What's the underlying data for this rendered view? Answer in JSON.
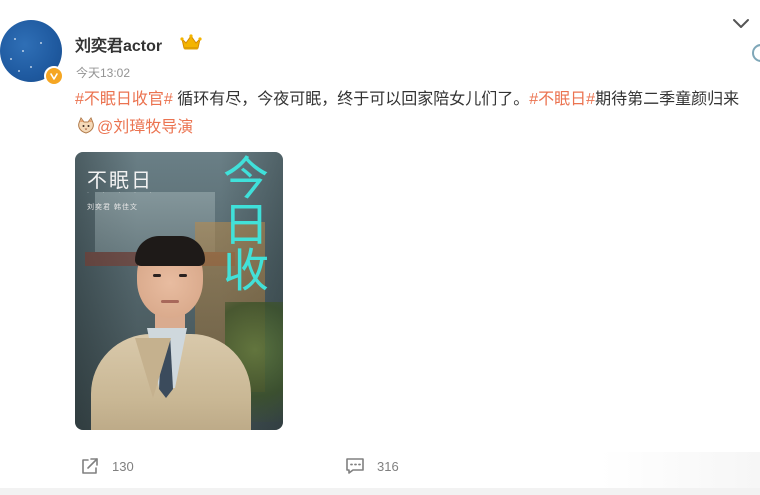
{
  "post": {
    "author": "刘奕君actor",
    "timestamp": "今天13:02",
    "text": {
      "topic1": "#不眠日收官#",
      "body1": " 循环有尽，今夜可眠，终于可以回家陪女儿们了。",
      "topic2": "#不眠日#",
      "body2": "期待第二季童颜归来",
      "mention": "@刘璋牧导演"
    },
    "poster": {
      "title": "不眠日",
      "cast": "刘奕君  韩佳文",
      "vertical_text": "今日收"
    }
  },
  "actions": {
    "repost_count": "130",
    "comment_count": "316"
  },
  "colors": {
    "link": "#eb7350",
    "verified_badge": "#f5a623",
    "poster_accent": "#3fe7e0"
  },
  "icons": {
    "more": "chevron-down-icon",
    "repost": "share-icon",
    "comment": "comment-icon",
    "badge": "crown-icon"
  }
}
